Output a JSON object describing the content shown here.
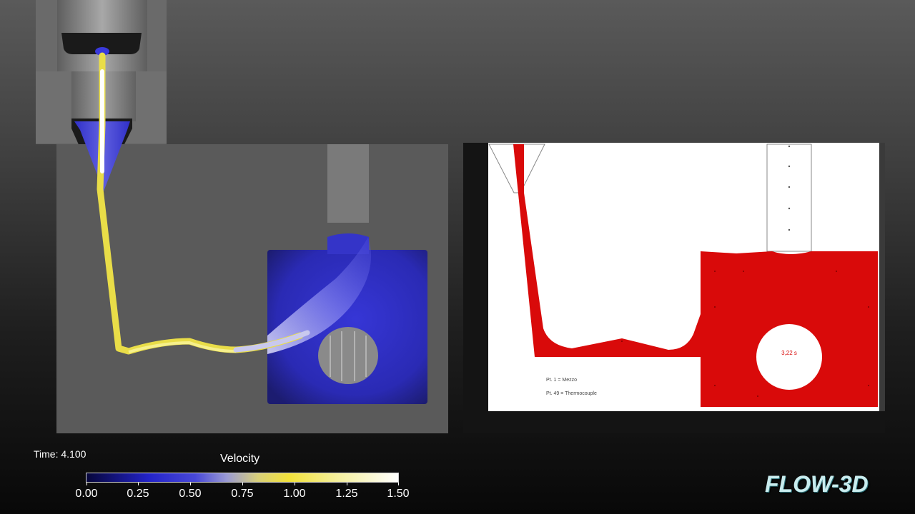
{
  "simulation": {
    "time_label": "Time: 4.100",
    "colorbar_title": "Velocity",
    "colorbar_ticks": [
      "0.00",
      "0.25",
      "0.50",
      "0.75",
      "1.00",
      "1.25",
      "1.50"
    ],
    "brand": "FLOW-3D"
  },
  "comparison": {
    "timestamp": "3,22 s",
    "legend_line1": "Pt. 1 = Mezzo",
    "legend_line2": "Pt. 49 = Thermocouple"
  },
  "colors": {
    "velocity_low": "#2323c8",
    "velocity_mid": "#f2e23a",
    "velocity_high": "#ffffff",
    "metal_fill": "#d90a0a"
  }
}
